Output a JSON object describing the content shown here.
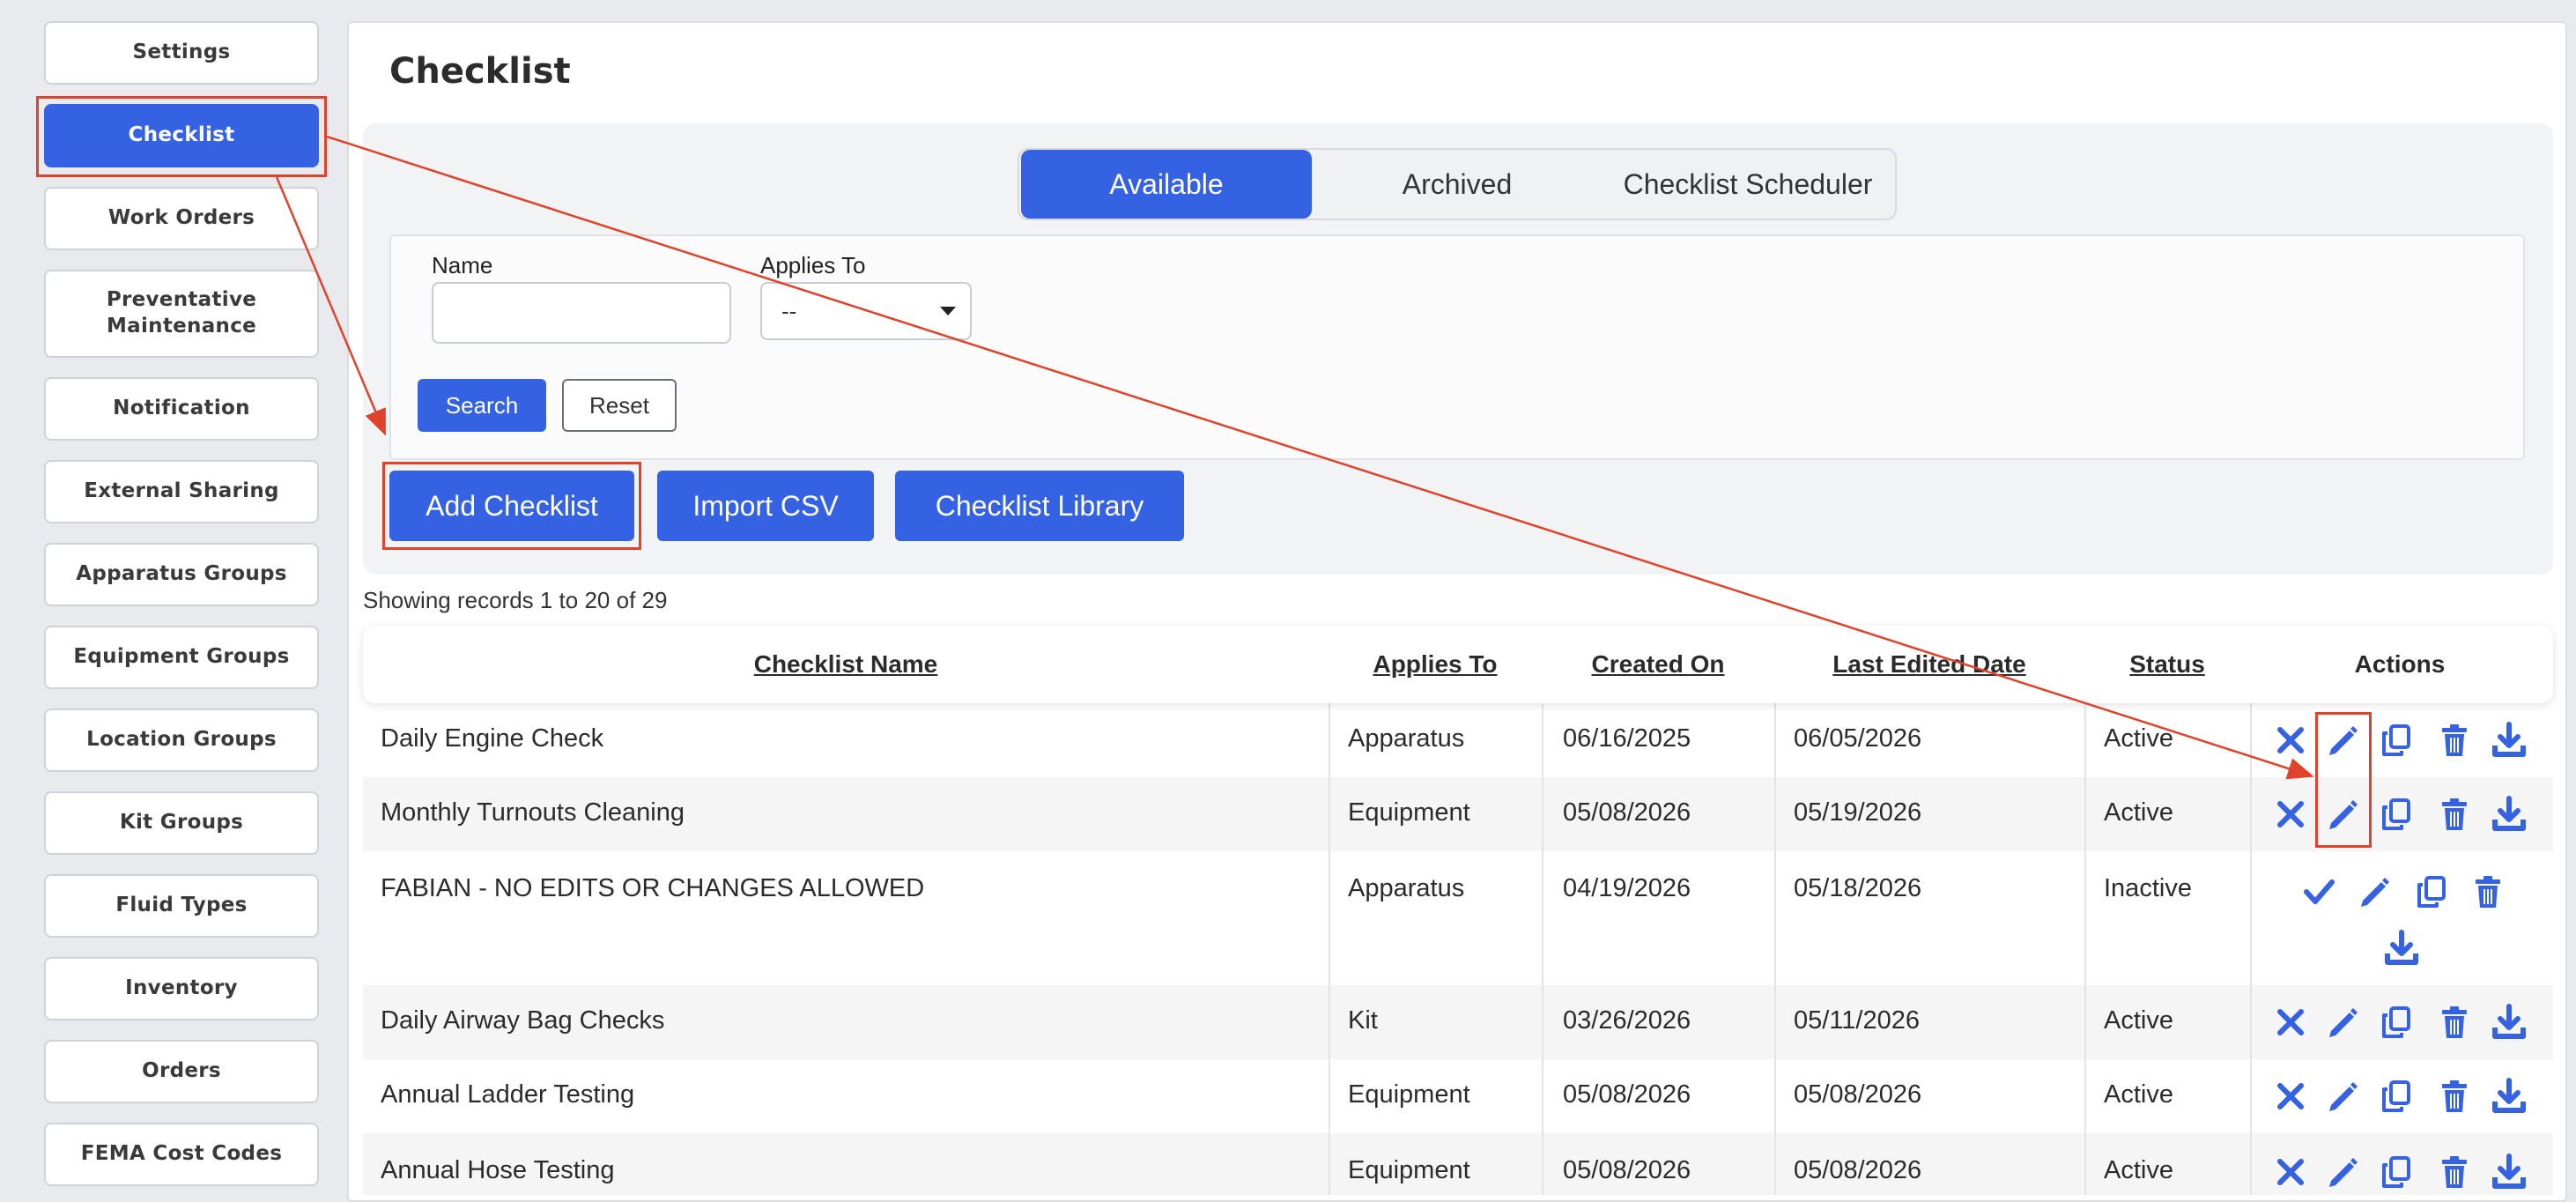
{
  "sidebar": {
    "items": [
      {
        "label": "Settings"
      },
      {
        "label": "Checklist"
      },
      {
        "label": "Work Orders"
      },
      {
        "label": "Preventative Maintenance"
      },
      {
        "label": "Notification"
      },
      {
        "label": "External Sharing"
      },
      {
        "label": "Apparatus Groups"
      },
      {
        "label": "Equipment Groups"
      },
      {
        "label": "Location Groups"
      },
      {
        "label": "Kit Groups"
      },
      {
        "label": "Fluid Types"
      },
      {
        "label": "Inventory"
      },
      {
        "label": "Orders"
      },
      {
        "label": "FEMA Cost Codes"
      }
    ],
    "active_index": 1
  },
  "page": {
    "title": "Checklist"
  },
  "tabs": [
    {
      "label": "Available",
      "active": true
    },
    {
      "label": "Archived",
      "active": false
    },
    {
      "label": "Checklist Scheduler",
      "active": false
    }
  ],
  "filters": {
    "name_label": "Name",
    "name_value": "",
    "applies_to_label": "Applies To",
    "applies_to_value": "--",
    "search_label": "Search",
    "reset_label": "Reset"
  },
  "actions": {
    "add_label": "Add Checklist",
    "import_label": "Import CSV",
    "library_label": "Checklist Library"
  },
  "records_text": "Showing records 1 to 20 of 29",
  "table": {
    "headers": [
      "Checklist Name",
      "Applies To",
      "Created On",
      "Last Edited Date",
      "Status",
      "Actions"
    ],
    "rows": [
      {
        "name": "Daily Engine Check",
        "applies_to": "Apparatus",
        "created": "06/16/2025",
        "edited": "06/05/2026",
        "status": "Active"
      },
      {
        "name": "Monthly Turnouts Cleaning",
        "applies_to": "Equipment",
        "created": "05/08/2026",
        "edited": "05/19/2026",
        "status": "Active"
      },
      {
        "name": "FABIAN - NO EDITS OR CHANGES ALLOWED",
        "applies_to": "Apparatus",
        "created": "04/19/2026",
        "edited": "05/18/2026",
        "status": "Inactive"
      },
      {
        "name": "Daily Airway Bag Checks",
        "applies_to": "Kit",
        "created": "03/26/2026",
        "edited": "05/11/2026",
        "status": "Active"
      },
      {
        "name": "Annual Ladder Testing",
        "applies_to": "Equipment",
        "created": "05/08/2026",
        "edited": "05/08/2026",
        "status": "Active"
      },
      {
        "name": "Annual Hose Testing",
        "applies_to": "Equipment",
        "created": "05/08/2026",
        "edited": "05/08/2026",
        "status": "Active"
      }
    ]
  },
  "icons": {
    "deactivate": "x-icon",
    "activate": "check-icon",
    "edit": "pencil-icon",
    "copy": "copy-icon",
    "delete": "trash-icon",
    "download": "download-icon"
  },
  "colors": {
    "accent": "#3562e3",
    "annotation": "#e0432b"
  }
}
